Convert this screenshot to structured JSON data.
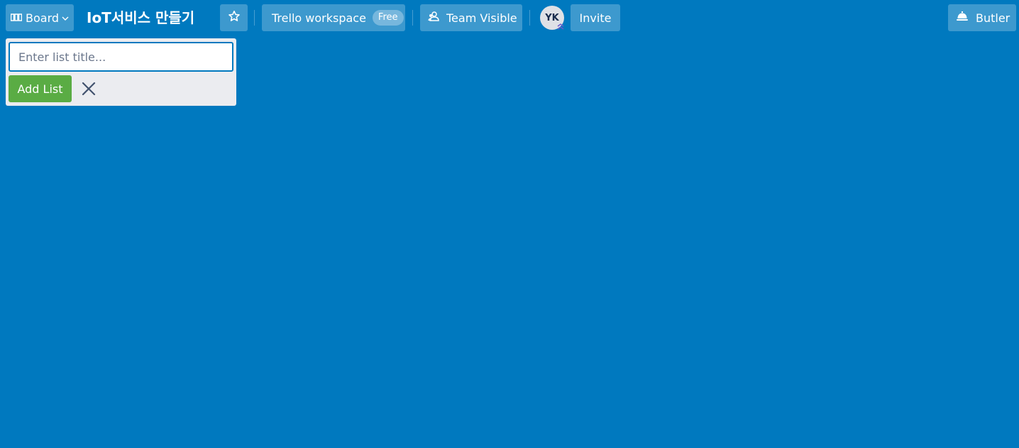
{
  "header": {
    "board_menu_label": "Board",
    "board_title": "IoT서비스 만들기",
    "workspace_label": "Trello workspace",
    "workspace_badge": "Free",
    "visibility_label": "Team Visible",
    "avatar_initials": "YK",
    "invite_label": "Invite",
    "butler_label": "Butler"
  },
  "add_list": {
    "placeholder": "Enter list title...",
    "value": "",
    "submit_label": "Add List"
  },
  "icons": {
    "board": "board-icon",
    "chevron": "chevron-down-icon",
    "star": "star-icon",
    "visibility": "team-visible-icon",
    "avatar_badge": "admin-chevrons-icon",
    "butler": "butler-bell-icon",
    "close": "close-icon"
  },
  "colors": {
    "background": "#0079bf",
    "add_button": "#5aac44",
    "list_panel": "#ebecf0",
    "input_border": "#0079bf"
  }
}
